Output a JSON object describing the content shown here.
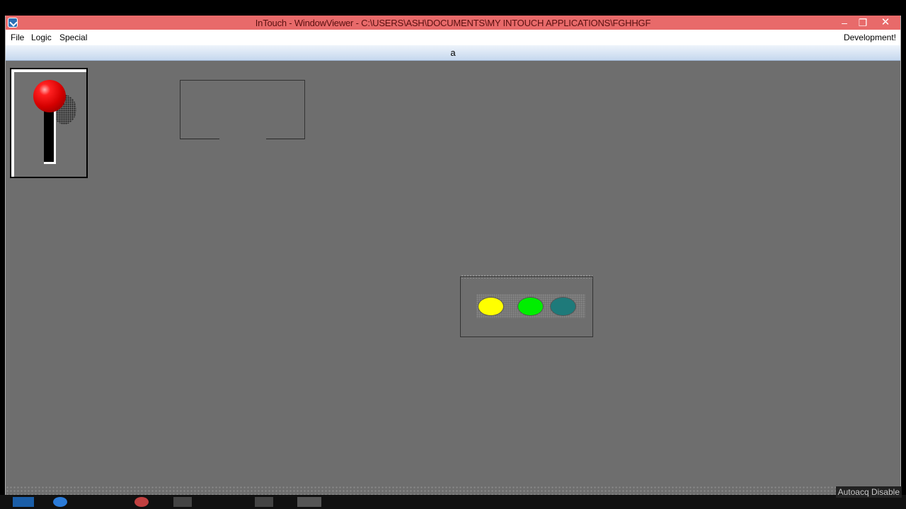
{
  "window": {
    "title": "InTouch - WindowViewer - C:\\USERS\\ASH\\DOCUMENTS\\MY INTOUCH APPLICATIONS\\FGHHGF",
    "controls": {
      "minimize": "–",
      "maximize": "❐",
      "close": "✕"
    }
  },
  "menu": {
    "file": "File",
    "logic": "Logic",
    "special": "Special",
    "development": "Development!"
  },
  "infobar": {
    "text": "a"
  },
  "lights": [
    {
      "name": "yellow",
      "color": "#ffff00"
    },
    {
      "name": "green",
      "color": "#00ee00"
    },
    {
      "name": "teal",
      "color": "#1e7a7a"
    }
  ],
  "colors": {
    "canvas": "#6e6e6e",
    "titlebar": "#e86a6a",
    "knob": "#d40000"
  },
  "status": {
    "text": "Autoacq Disable"
  }
}
